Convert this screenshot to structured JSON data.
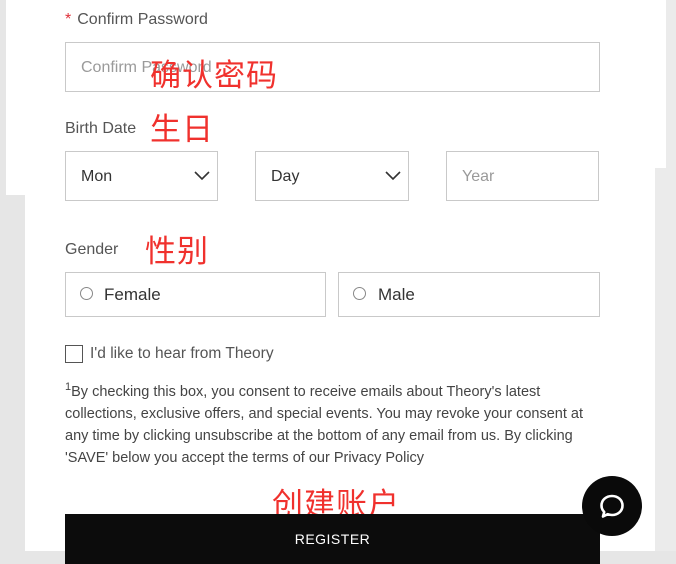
{
  "confirm_password": {
    "label": "Confirm Password",
    "required_mark": "*",
    "placeholder": "Confirm Password",
    "annotation": "确认密码"
  },
  "birth_date": {
    "label": "Birth Date",
    "annotation": "生日",
    "month_value": "Mon",
    "day_value": "Day",
    "year_placeholder": "Year"
  },
  "gender": {
    "label": "Gender",
    "annotation": "性别",
    "options": [
      "Female",
      "Male"
    ]
  },
  "newsletter": {
    "checkbox_label": "I'd like to hear from Theory",
    "footnote_mark": "1",
    "consent_text": "By checking this box, you consent to receive emails about Theory's latest collections, exclusive offers, and special events. You may revoke your consent at any time by clicking unsubscribe at the bottom of any email from us. By clicking 'SAVE' below you accept the terms of our Privacy Policy"
  },
  "register": {
    "annotation": "创建账户",
    "button_label": "REGISTER"
  },
  "colors": {
    "required": "#e0303a",
    "annotation": "#f0312d",
    "button_bg": "#0c0c0c"
  },
  "icons": [
    "chevron-down-icon",
    "chat-bubble-icon"
  ]
}
